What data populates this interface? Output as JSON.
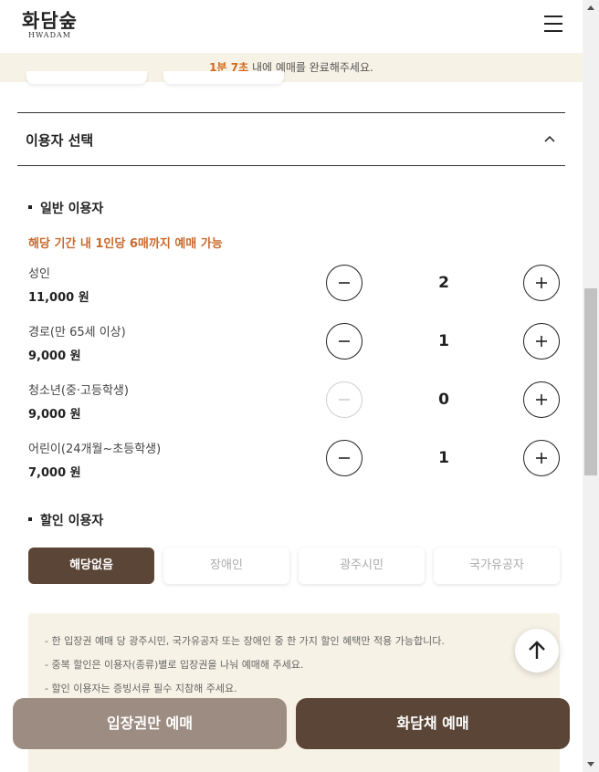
{
  "header": {
    "logo_korean": "화담숲",
    "logo_english": "HWADAM",
    "menu_icon": "hamburger-menu-icon"
  },
  "timer": {
    "time": "1분 7초",
    "message": " 내에 예매를 완료해주세요."
  },
  "section": {
    "title": "이용자 선택",
    "toggle_icon": "chevron-up-icon"
  },
  "general": {
    "title": "일반 이용자",
    "notice": "해당 기간 내 1인당 6매까지 예매 가능",
    "rows": [
      {
        "label": "성인",
        "price": "11,000 원",
        "count": "2",
        "minus_enabled": true
      },
      {
        "label": "경로(만 65세 이상)",
        "price": "9,000 원",
        "count": "1",
        "minus_enabled": true
      },
      {
        "label": "청소년(중·고등학생)",
        "price": "9,000 원",
        "count": "0",
        "minus_enabled": false
      },
      {
        "label": "어린이(24개월~초등학생)",
        "price": "7,000 원",
        "count": "1",
        "minus_enabled": true
      }
    ]
  },
  "discount": {
    "title": "할인 이용자",
    "options": [
      {
        "label": "해당없음",
        "selected": true
      },
      {
        "label": "장애인",
        "selected": false
      },
      {
        "label": "광주시민",
        "selected": false
      },
      {
        "label": "국가유공자",
        "selected": false
      }
    ]
  },
  "info": {
    "lines": [
      "-   한 입장권 예매 당 광주시민, 국가유공자 또는 장애인 중 한 가지 할인 혜택만 적용 가능합니다.",
      "-   중복 할인은 이용자(종류)별로 입장권을 나눠 예매해 주세요.",
      "-   할인 이용자는 증빙서류 필수 지참해 주세요."
    ]
  },
  "fab": {
    "icon": "arrow-up-icon"
  },
  "bottom": {
    "ticket_only_label": "입장권만 예매",
    "hwadamchae_label": "화담채 예매"
  },
  "colors": {
    "brand_brown": "#5b4536",
    "muted_brown": "#9d8c82",
    "accent_orange": "#d2691e",
    "cream_bg": "#f7f2e6"
  }
}
